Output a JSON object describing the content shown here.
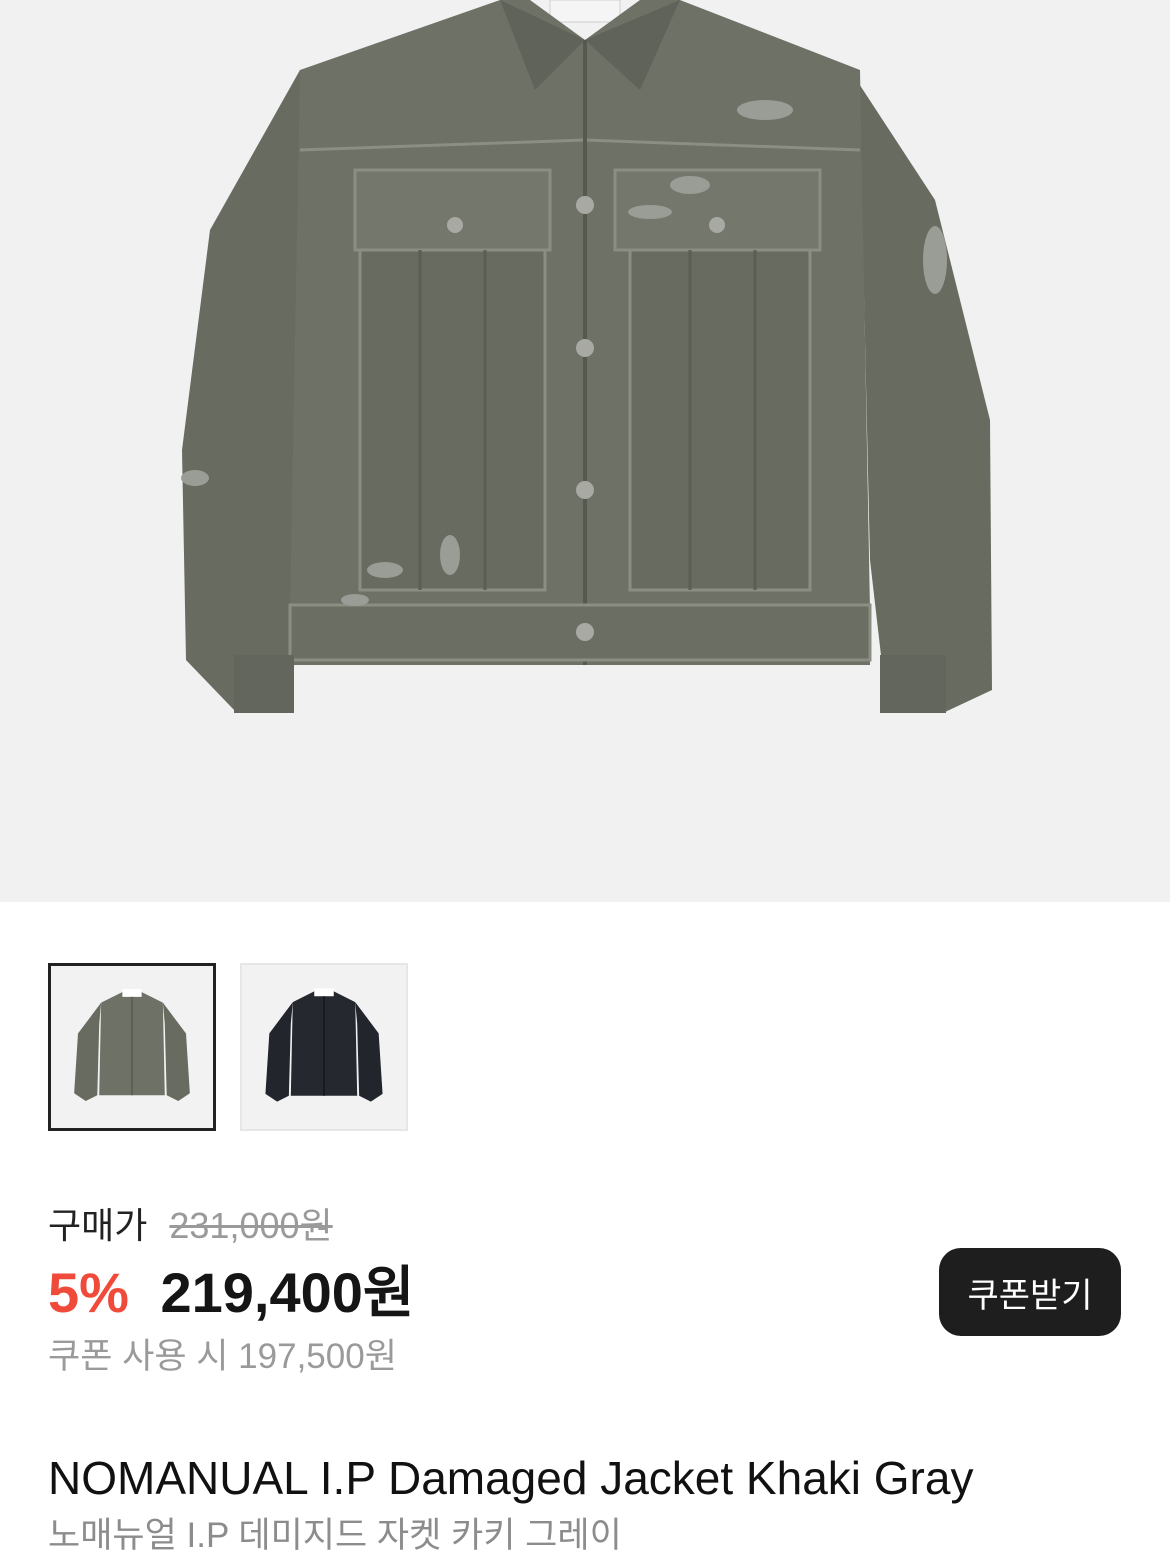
{
  "product": {
    "images": [
      {
        "color_name": "Khaki Gray",
        "swatch": "#6b6f64",
        "selected": true
      },
      {
        "color_name": "Black",
        "swatch": "#23252d",
        "selected": false
      }
    ]
  },
  "price": {
    "label": "구매가",
    "original": "231,000원",
    "discount": "5%",
    "sale": "219,400원",
    "coupon_note": "쿠폰 사용 시 197,500원",
    "discount_color": "#f04a3a"
  },
  "coupon_button": {
    "label": "쿠폰받기"
  },
  "title": {
    "en": "NOMANUAL I.P Damaged Jacket Khaki Gray",
    "ko": "노매뉴얼 I.P 데미지드 자켓 카키 그레이"
  }
}
